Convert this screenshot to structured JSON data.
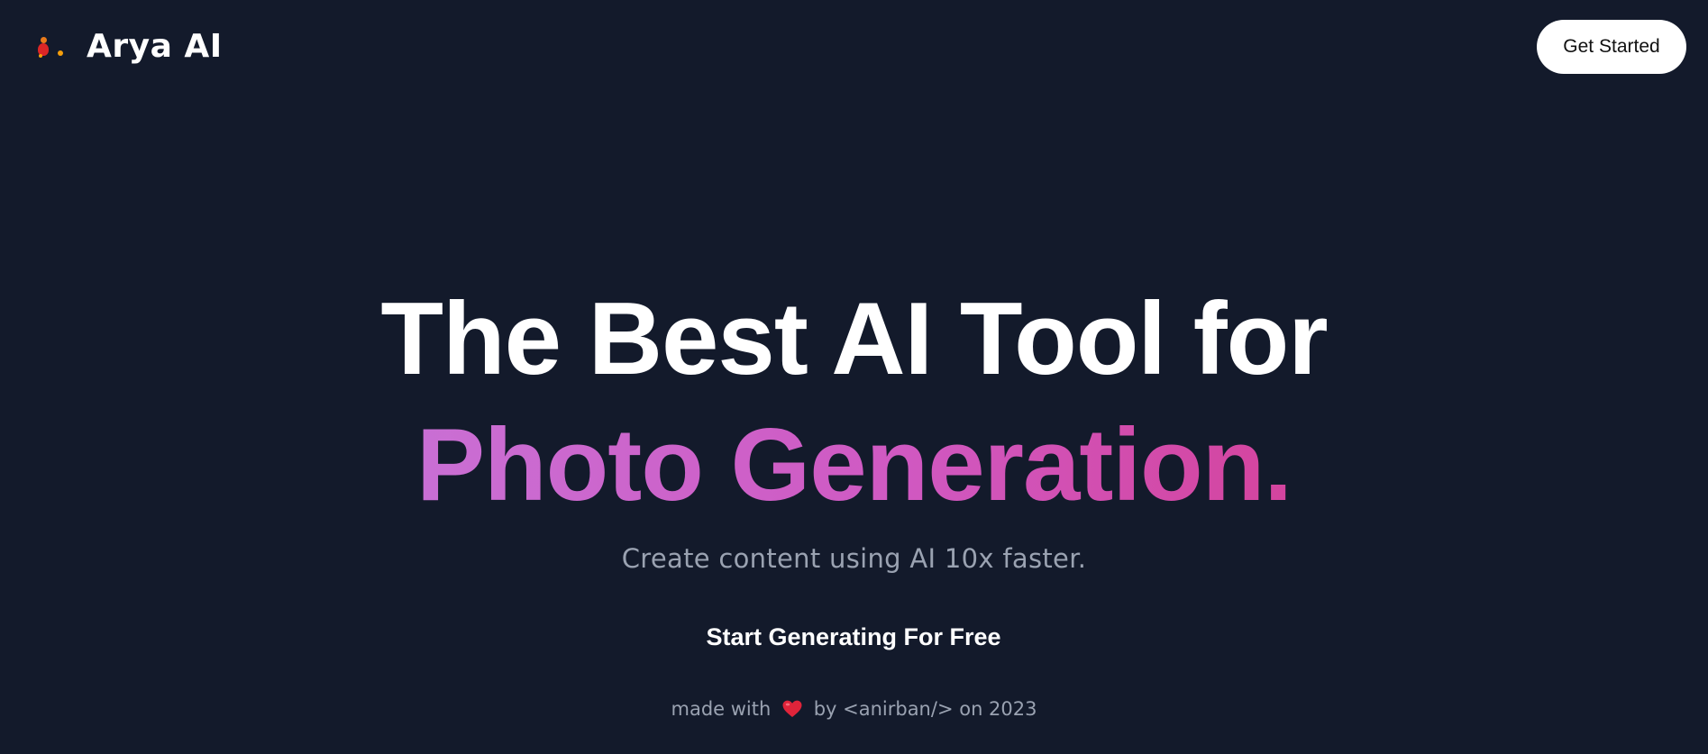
{
  "navbar": {
    "brand_name": "Arya AI",
    "logo_icon": "rocket-figure-icon",
    "cta_label": "Get Started"
  },
  "hero": {
    "headline_line1": "The Best AI Tool for",
    "headline_line2": "Photo Generation.",
    "subtitle": "Create content using AI 10x faster.",
    "cta_label": "Start Generating For Free"
  },
  "footer": {
    "prefix": "made with",
    "heart_icon": "heart-icon",
    "suffix": "by <anirban/> on 2023"
  },
  "colors": {
    "background": "#131a2b",
    "heading": "#ffffff",
    "muted_text": "#9aa2b1",
    "gradient_start": "#c96fd4",
    "gradient_end": "#d4449e",
    "heart": "#e0243a"
  }
}
